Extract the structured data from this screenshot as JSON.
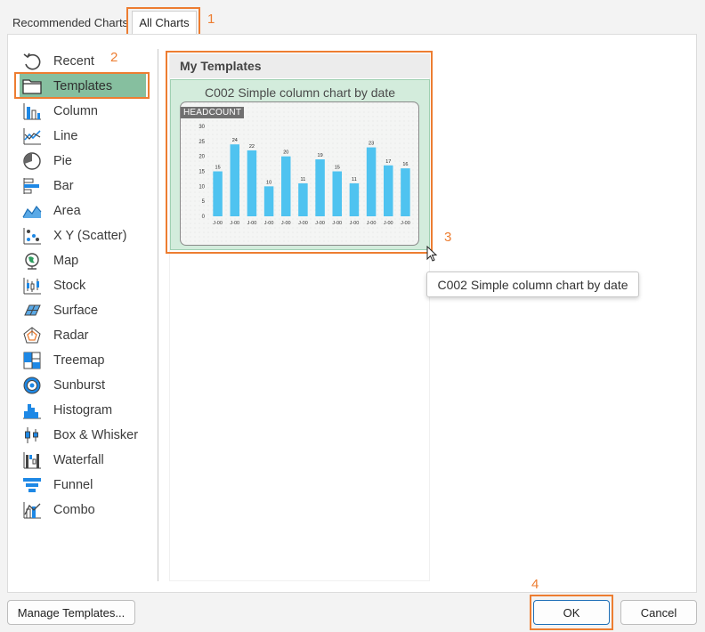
{
  "tabs": {
    "recommended": "Recommended Charts",
    "all": "All Charts"
  },
  "annotations": [
    "1",
    "2",
    "3",
    "4"
  ],
  "chart_types": [
    {
      "label": "Recent",
      "icon": "recent-icon"
    },
    {
      "label": "Templates",
      "icon": "templates-folder-icon",
      "selected": true
    },
    {
      "label": "Column",
      "icon": "column-chart-icon"
    },
    {
      "label": "Line",
      "icon": "line-chart-icon"
    },
    {
      "label": "Pie",
      "icon": "pie-chart-icon"
    },
    {
      "label": "Bar",
      "icon": "bar-chart-icon"
    },
    {
      "label": "Area",
      "icon": "area-chart-icon"
    },
    {
      "label": "X Y (Scatter)",
      "icon": "scatter-chart-icon"
    },
    {
      "label": "Map",
      "icon": "map-chart-icon"
    },
    {
      "label": "Stock",
      "icon": "stock-chart-icon"
    },
    {
      "label": "Surface",
      "icon": "surface-chart-icon"
    },
    {
      "label": "Radar",
      "icon": "radar-chart-icon"
    },
    {
      "label": "Treemap",
      "icon": "treemap-chart-icon"
    },
    {
      "label": "Sunburst",
      "icon": "sunburst-chart-icon"
    },
    {
      "label": "Histogram",
      "icon": "histogram-chart-icon"
    },
    {
      "label": "Box & Whisker",
      "icon": "box-whisker-chart-icon"
    },
    {
      "label": "Waterfall",
      "icon": "waterfall-chart-icon"
    },
    {
      "label": "Funnel",
      "icon": "funnel-chart-icon"
    },
    {
      "label": "Combo",
      "icon": "combo-chart-icon"
    }
  ],
  "gallery": {
    "header": "My Templates",
    "template_title": "C002 Simple column chart by date",
    "tooltip": "C002 Simple column chart by date"
  },
  "chart_data": {
    "type": "bar",
    "title": "HEADCOUNT",
    "categories": [
      "J-00",
      "J-00",
      "J-00",
      "J-00",
      "J-00",
      "J-00",
      "J-00",
      "J-00",
      "J-00",
      "J-00",
      "J-00",
      "J-00"
    ],
    "values": [
      15,
      24,
      22,
      10,
      20,
      11,
      19,
      15,
      11,
      23,
      17,
      16
    ],
    "y_ticks": [
      "30",
      "25",
      "20",
      "15",
      "10",
      "5",
      "0"
    ],
    "ylim": [
      0,
      30
    ],
    "grid": false,
    "bar_color": "#4fc3f0"
  },
  "buttons": {
    "manage": "Manage Templates...",
    "ok": "OK",
    "cancel": "Cancel"
  },
  "colors": {
    "highlight": "#ed7d31",
    "selected": "#86bf9f",
    "template_bg": "#d3ecdc"
  }
}
